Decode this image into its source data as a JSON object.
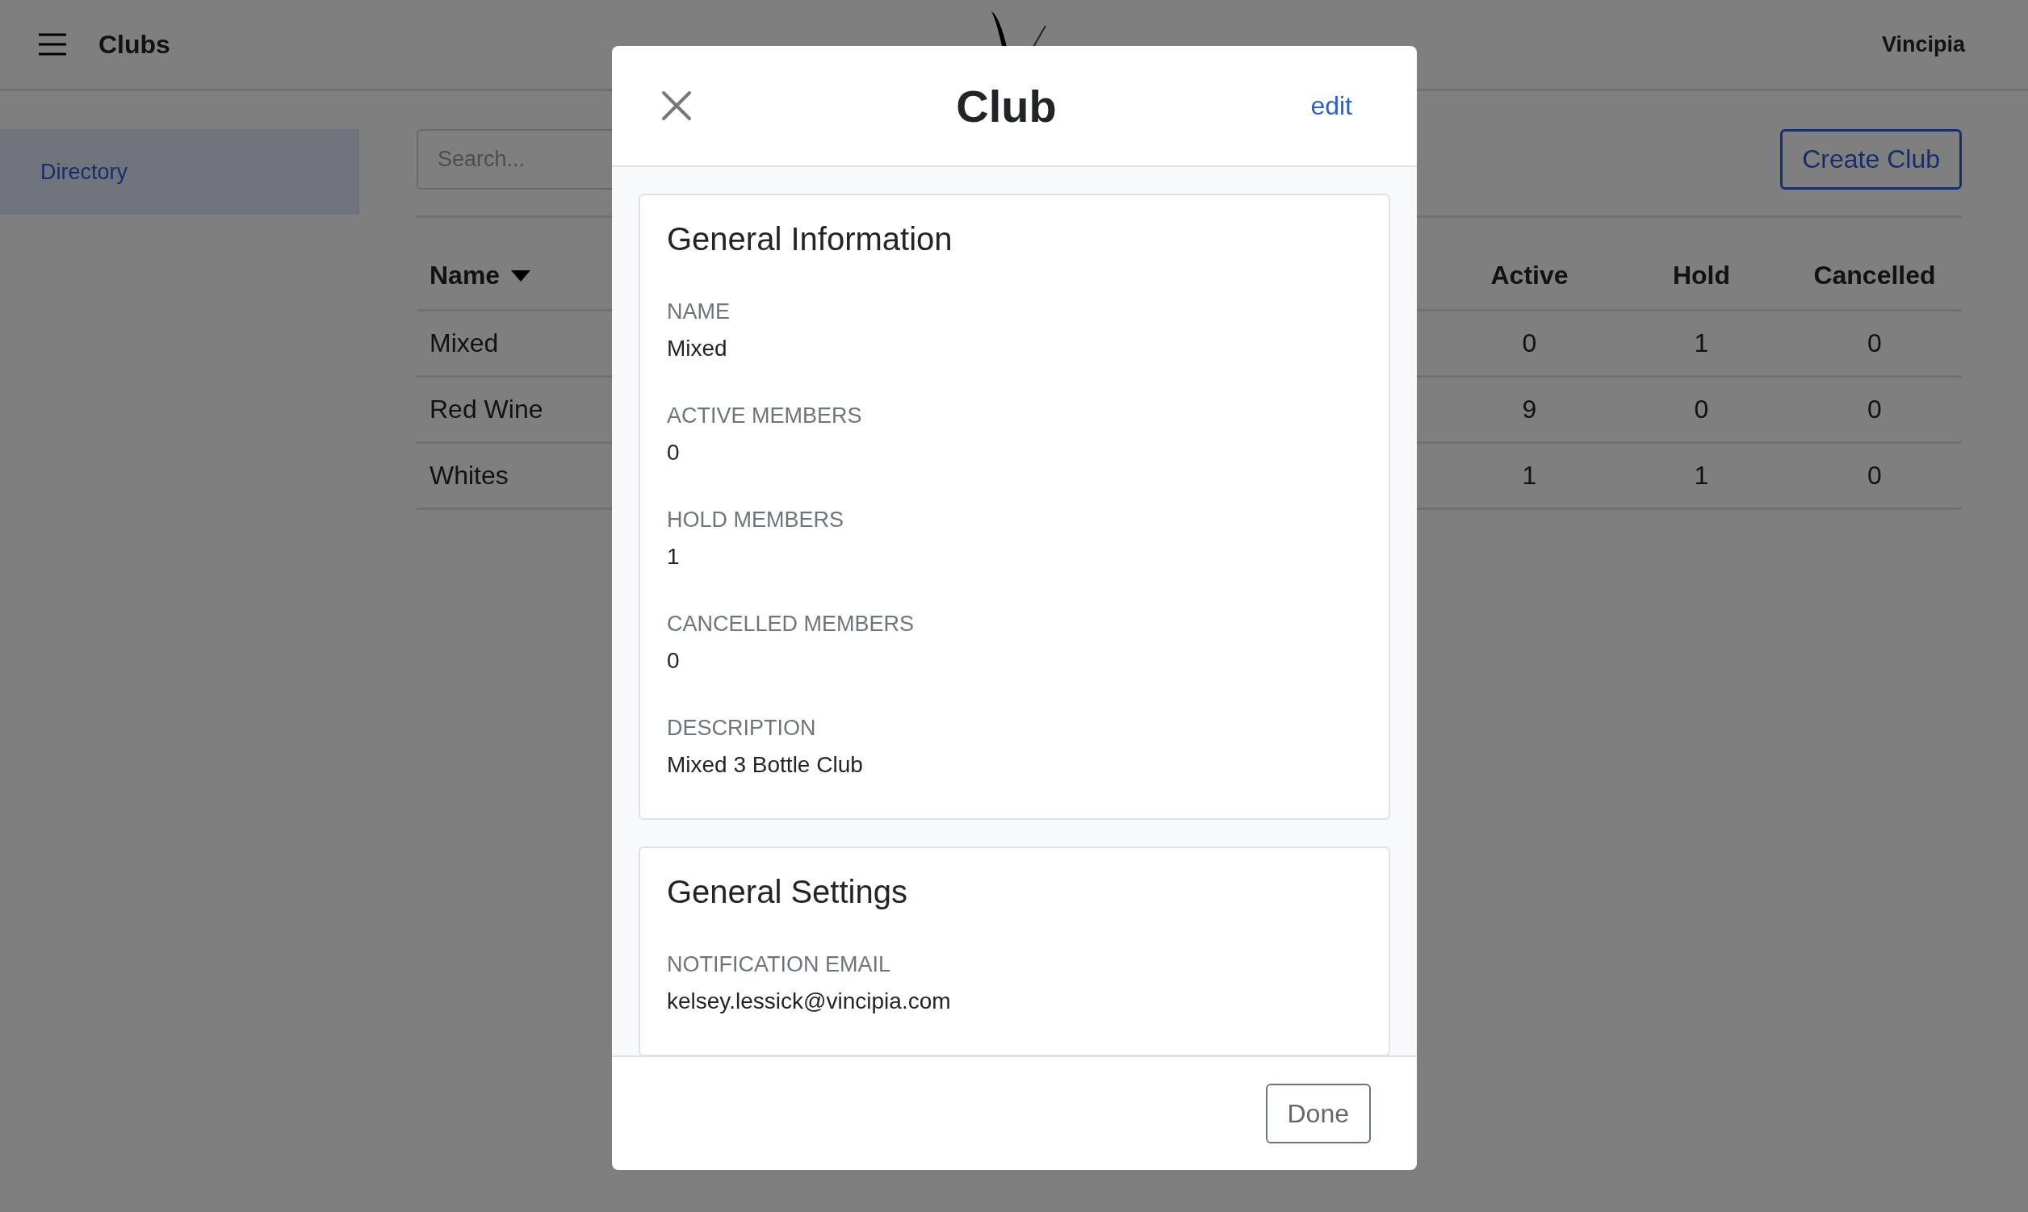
{
  "header": {
    "title": "Clubs",
    "account": "Vincipia"
  },
  "sidebar": {
    "items": [
      {
        "label": "Directory",
        "selected": true
      }
    ]
  },
  "search": {
    "placeholder": "Search..."
  },
  "create_button": "Create Club",
  "table": {
    "columns": [
      {
        "label": "Name",
        "sorted": true
      },
      {
        "label": "Active",
        "sorted": false
      },
      {
        "label": "Hold",
        "sorted": false
      },
      {
        "label": "Cancelled",
        "sorted": false
      }
    ],
    "rows": [
      [
        "Mixed",
        "0",
        "1",
        "0"
      ],
      [
        "Red Wine",
        "9",
        "0",
        "0"
      ],
      [
        "Whites",
        "1",
        "1",
        "0"
      ]
    ]
  },
  "modal": {
    "title": "Club",
    "edit_link": "edit",
    "sections": [
      {
        "title": "General Information",
        "fields": [
          {
            "label": "NAME",
            "value": "Mixed"
          },
          {
            "label": "ACTIVE MEMBERS",
            "value": "0"
          },
          {
            "label": "HOLD MEMBERS",
            "value": "1"
          },
          {
            "label": "CANCELLED MEMBERS",
            "value": "0"
          },
          {
            "label": "DESCRIPTION",
            "value": "Mixed 3 Bottle Club"
          }
        ]
      },
      {
        "title": "General Settings",
        "fields": [
          {
            "label": "NOTIFICATION EMAIL",
            "value": "kelsey.lessick@vincipia.com"
          }
        ]
      }
    ],
    "done_button": "Done"
  }
}
